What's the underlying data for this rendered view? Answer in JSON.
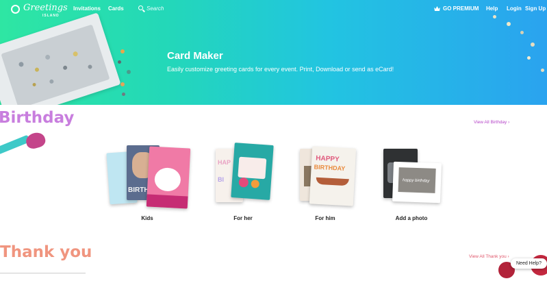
{
  "nav": {
    "logo_text": "Greetings",
    "logo_sub": "ISLAND",
    "invitations": "Invitations",
    "cards": "Cards",
    "search_placeholder": "Search",
    "premium": "GO PREMIUM",
    "help": "Help",
    "login": "Login",
    "signup": "Sign Up"
  },
  "hero": {
    "title": "Card Maker",
    "subtitle": "Easily customize greeting cards for every event. Print, Download or send as eCard!"
  },
  "birthday": {
    "title": "Birthday",
    "view_all": "View All Birthday ›",
    "categories": [
      {
        "label": "Kids"
      },
      {
        "label": "For her"
      },
      {
        "label": "For him"
      },
      {
        "label": "Add a photo"
      }
    ]
  },
  "thank_you": {
    "title": "Thank you",
    "view_all": "View All Thank you ›"
  },
  "help_bubble": "Need Help?",
  "card_text": {
    "kids_birth": "BIRTH",
    "her_hap": "HAP",
    "her_bi": "BI",
    "him_happy": "HAPPY",
    "him_birthday": "BIRTHDAY",
    "photo_hb": "happy birthday"
  },
  "colors": {
    "birthday_title": "#c87ede",
    "thanks_title": "#f0957f",
    "view_bday": "#b544c8",
    "view_thanks": "#e0566b"
  }
}
